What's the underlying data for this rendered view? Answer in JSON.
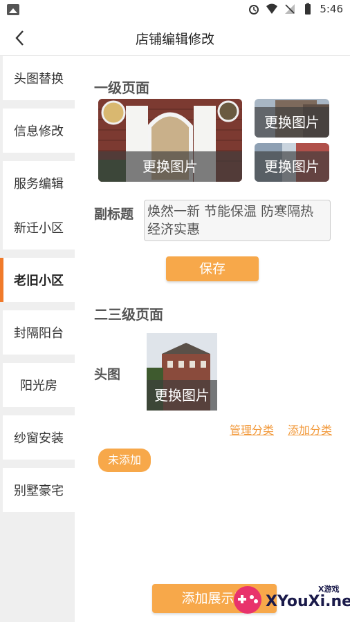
{
  "status_bar": {
    "time": "5:46"
  },
  "header": {
    "title": "店铺编辑修改"
  },
  "sidebar": {
    "items": [
      {
        "label": "头图替换"
      },
      {
        "label": "信息修改"
      },
      {
        "label": "服务编辑"
      },
      {
        "label": "新迁小区"
      },
      {
        "label": "老旧小区",
        "active": true
      },
      {
        "label": "封隔阳台"
      },
      {
        "label": "阳光房"
      },
      {
        "label": "纱窗安装"
      },
      {
        "label": "别墅豪宅"
      }
    ]
  },
  "main": {
    "section1_title": "一级页面",
    "replace_label": "更换图片",
    "subtitle_label": "副标题",
    "subtitle_value": "焕然一新 节能保温 防寒隔热 经济实惠",
    "save_label": "保存",
    "section2_title": "二三级页面",
    "head_image_label": "头图",
    "manage_category_label": "管理分类",
    "add_category_label": "添加分类",
    "not_added_label": "未添加",
    "add_display_label": "添加展示叫"
  },
  "watermark": {
    "brand": "XYouXi.net",
    "small": "X游戏"
  },
  "colors": {
    "accent": "#f7a84a",
    "active_marker": "#f07a2a"
  }
}
